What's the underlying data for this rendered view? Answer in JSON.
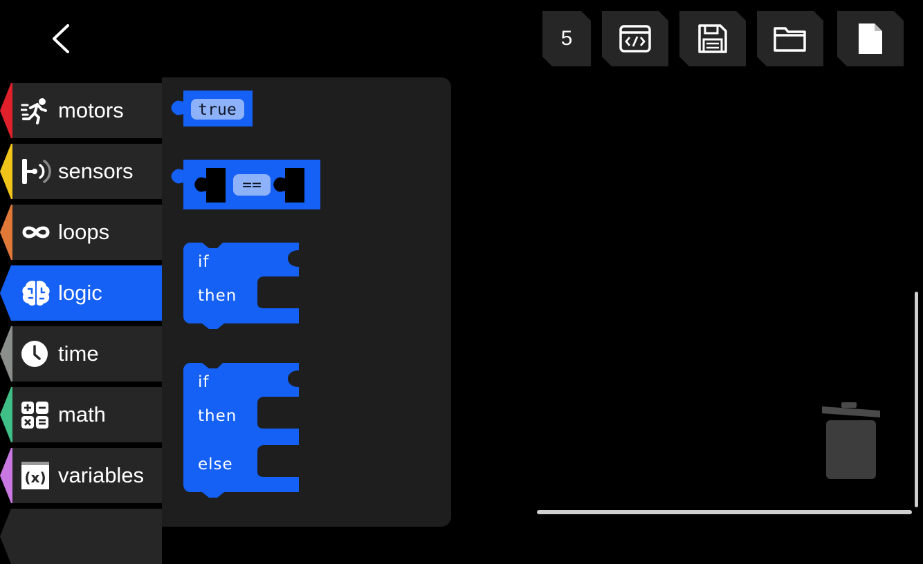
{
  "toolbar": {
    "block_count": "5",
    "buttons": [
      "code-view",
      "save",
      "open-folder",
      "new-file"
    ]
  },
  "categories": [
    {
      "label": "motors",
      "color": "#e0202a",
      "icon": "running-person-icon"
    },
    {
      "label": "sensors",
      "color": "#f0c419",
      "icon": "sensor-icon"
    },
    {
      "label": "loops",
      "color": "#e07838",
      "icon": "infinity-icon"
    },
    {
      "label": "logic",
      "color": "#1560f5",
      "icon": "brain-icon",
      "active": true
    },
    {
      "label": "time",
      "color": "#8a8f8c",
      "icon": "clock-icon"
    },
    {
      "label": "math",
      "color": "#3fbf87",
      "icon": "calculator-icon"
    },
    {
      "label": "variables",
      "color": "#c878e0",
      "icon": "variable-icon"
    }
  ],
  "blocks": {
    "boolean_value": "true",
    "compare_op": "==",
    "if_then": {
      "if": "if",
      "then": "then"
    },
    "if_then_else": {
      "if": "if",
      "then": "then",
      "else": "else"
    }
  },
  "colors": {
    "accent": "#1560f5",
    "pill": "#8eb2fa",
    "panel": "#262626",
    "flyout": "#1e1e1e"
  }
}
